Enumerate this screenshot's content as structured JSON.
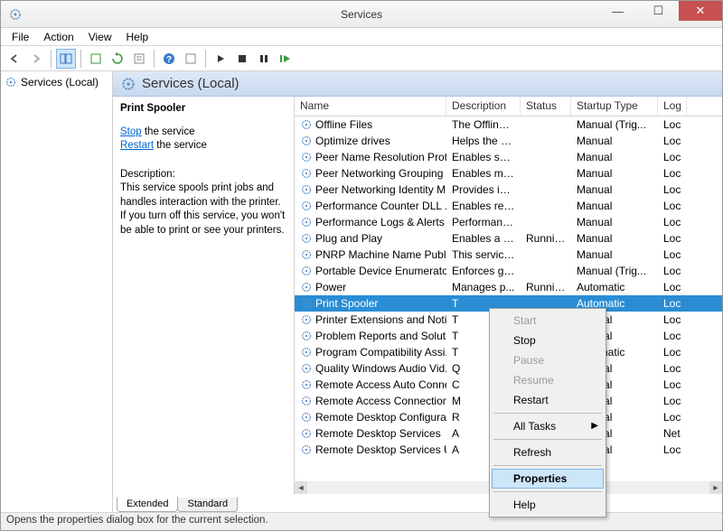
{
  "window": {
    "title": "Services"
  },
  "menu": {
    "file": "File",
    "action": "Action",
    "view": "View",
    "help": "Help"
  },
  "tree": {
    "root": "Services (Local)"
  },
  "header": {
    "title": "Services (Local)"
  },
  "detail": {
    "name": "Print Spooler",
    "stop_link": "Stop",
    "stop_after": " the service",
    "restart_link": "Restart",
    "restart_after": " the service",
    "desc_label": "Description:",
    "desc_text": "This service spools print jobs and handles interaction with the printer. If you turn off this service, you won't be able to print or see your printers."
  },
  "columns": {
    "name": "Name",
    "desc": "Description",
    "status": "Status",
    "start": "Startup Type",
    "logon": "Log"
  },
  "rows": [
    {
      "name": "Offline Files",
      "desc": "The Offline ...",
      "status": "",
      "start": "Manual (Trig...",
      "logon": "Loc"
    },
    {
      "name": "Optimize drives",
      "desc": "Helps the c...",
      "status": "",
      "start": "Manual",
      "logon": "Loc"
    },
    {
      "name": "Peer Name Resolution Prot...",
      "desc": "Enables serv...",
      "status": "",
      "start": "Manual",
      "logon": "Loc"
    },
    {
      "name": "Peer Networking Grouping",
      "desc": "Enables mul...",
      "status": "",
      "start": "Manual",
      "logon": "Loc"
    },
    {
      "name": "Peer Networking Identity M...",
      "desc": "Provides ide...",
      "status": "",
      "start": "Manual",
      "logon": "Loc"
    },
    {
      "name": "Performance Counter DLL ...",
      "desc": "Enables rem...",
      "status": "",
      "start": "Manual",
      "logon": "Loc"
    },
    {
      "name": "Performance Logs & Alerts",
      "desc": "Performanc...",
      "status": "",
      "start": "Manual",
      "logon": "Loc"
    },
    {
      "name": "Plug and Play",
      "desc": "Enables a c...",
      "status": "Running",
      "start": "Manual",
      "logon": "Loc"
    },
    {
      "name": "PNRP Machine Name Publi...",
      "desc": "This service ...",
      "status": "",
      "start": "Manual",
      "logon": "Loc"
    },
    {
      "name": "Portable Device Enumerator...",
      "desc": "Enforces gr...",
      "status": "",
      "start": "Manual (Trig...",
      "logon": "Loc"
    },
    {
      "name": "Power",
      "desc": "Manages p...",
      "status": "Running",
      "start": "Automatic",
      "logon": "Loc"
    },
    {
      "name": "Print Spooler",
      "desc": "T",
      "status": "",
      "start": "Automatic",
      "logon": "Loc",
      "selected": true
    },
    {
      "name": "Printer Extensions and Notif...",
      "desc": "T",
      "status": "",
      "start": "Manual",
      "logon": "Loc"
    },
    {
      "name": "Problem Reports and Soluti...",
      "desc": "T",
      "status": "",
      "start": "Manual",
      "logon": "Loc"
    },
    {
      "name": "Program Compatibility Assi...",
      "desc": "T",
      "status": "",
      "start": "Automatic",
      "logon": "Loc"
    },
    {
      "name": "Quality Windows Audio Vid...",
      "desc": "Q",
      "status": "",
      "start": "Manual",
      "logon": "Loc"
    },
    {
      "name": "Remote Access Auto Conne...",
      "desc": "C",
      "status": "",
      "start": "Manual",
      "logon": "Loc"
    },
    {
      "name": "Remote Access Connection...",
      "desc": "M",
      "status": "",
      "start": "Manual",
      "logon": "Loc"
    },
    {
      "name": "Remote Desktop Configurat...",
      "desc": "R",
      "status": "",
      "start": "Manual",
      "logon": "Loc"
    },
    {
      "name": "Remote Desktop Services",
      "desc": "A",
      "status": "",
      "start": "Manual",
      "logon": "Net"
    },
    {
      "name": "Remote Desktop Services U...",
      "desc": "A",
      "status": "",
      "start": "Manual",
      "logon": "Loc"
    }
  ],
  "tabs": {
    "extended": "Extended",
    "standard": "Standard"
  },
  "ctx": {
    "start": "Start",
    "stop": "Stop",
    "pause": "Pause",
    "resume": "Resume",
    "restart": "Restart",
    "alltasks": "All Tasks",
    "refresh": "Refresh",
    "properties": "Properties",
    "help": "Help"
  },
  "status": "Opens the properties dialog box for the current selection."
}
